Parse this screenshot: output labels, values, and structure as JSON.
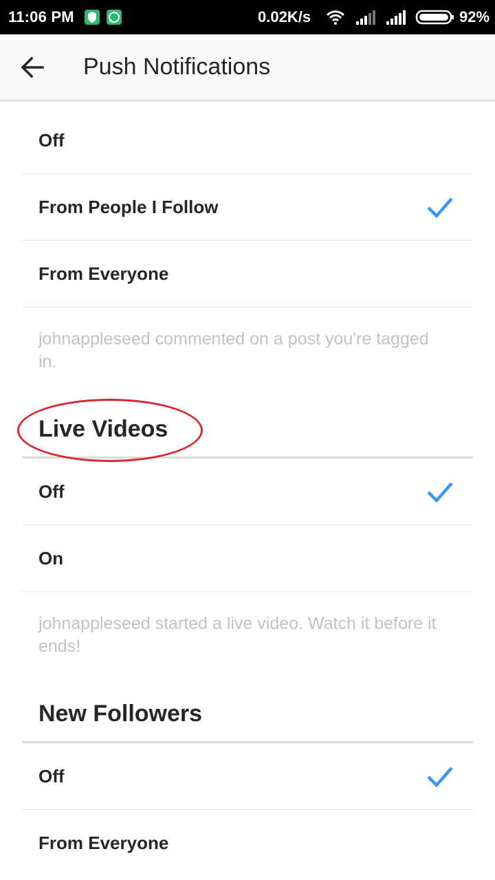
{
  "status_bar": {
    "time": "11:06 PM",
    "network_speed": "0.02K/s",
    "battery": "92%",
    "icons": [
      "shield-notification-icon",
      "whatsapp-icon",
      "wifi-icon",
      "signal-icon",
      "signal-icon",
      "battery-icon"
    ]
  },
  "app_bar": {
    "back_icon": "arrow-left-icon",
    "title": "Push Notifications"
  },
  "comments_section": {
    "options": [
      {
        "label": "Off",
        "selected": false
      },
      {
        "label": "From People I Follow",
        "selected": true
      },
      {
        "label": "From Everyone",
        "selected": false
      }
    ],
    "description": "johnappleseed commented on a post you're tagged in."
  },
  "live_videos_section": {
    "title": "Live Videos",
    "options": [
      {
        "label": "Off",
        "selected": true
      },
      {
        "label": "On",
        "selected": false
      }
    ],
    "description": "johnappleseed started a live video. Watch it before it ends!"
  },
  "new_followers_section": {
    "title": "New Followers",
    "options": [
      {
        "label": "Off",
        "selected": true
      },
      {
        "label": "From Everyone",
        "selected": false
      }
    ]
  },
  "colors": {
    "check_accent": "#3897f0",
    "annotation_red": "#d7282f",
    "description_gray": "#c2c2c2"
  }
}
